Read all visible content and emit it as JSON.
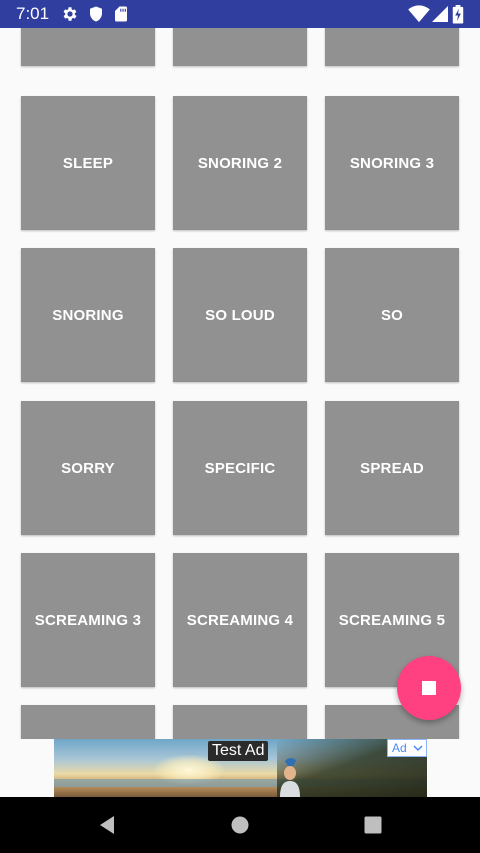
{
  "status_bar": {
    "time": "7:01",
    "icons": [
      "settings-icon",
      "shield-icon",
      "sd-card-icon",
      "wifi-icon",
      "cell-signal-icon",
      "battery-charging-icon"
    ],
    "background": "#303f9f"
  },
  "grid": {
    "tile_color": "#919191",
    "rows": [
      {
        "tiles": [
          "",
          "",
          ""
        ]
      },
      {
        "tiles": [
          "SLEEP",
          "SNORING 2",
          "SNORING 3"
        ]
      },
      {
        "tiles": [
          "SNORING",
          "SO LOUD",
          "SO"
        ]
      },
      {
        "tiles": [
          "SORRY",
          "SPECIFIC",
          "SPREAD"
        ]
      },
      {
        "tiles": [
          "SCREAMING 3",
          "SCREAMING 4",
          "SCREAMING 5"
        ]
      },
      {
        "tiles": [
          "",
          "",
          ""
        ]
      }
    ]
  },
  "ad": {
    "label": "Test Ad",
    "badge": "Ad"
  },
  "fab": {
    "icon": "stop-icon",
    "color": "#ff4081"
  },
  "nav_bar": {
    "icons": [
      "back-icon",
      "home-icon",
      "recents-icon"
    ]
  }
}
